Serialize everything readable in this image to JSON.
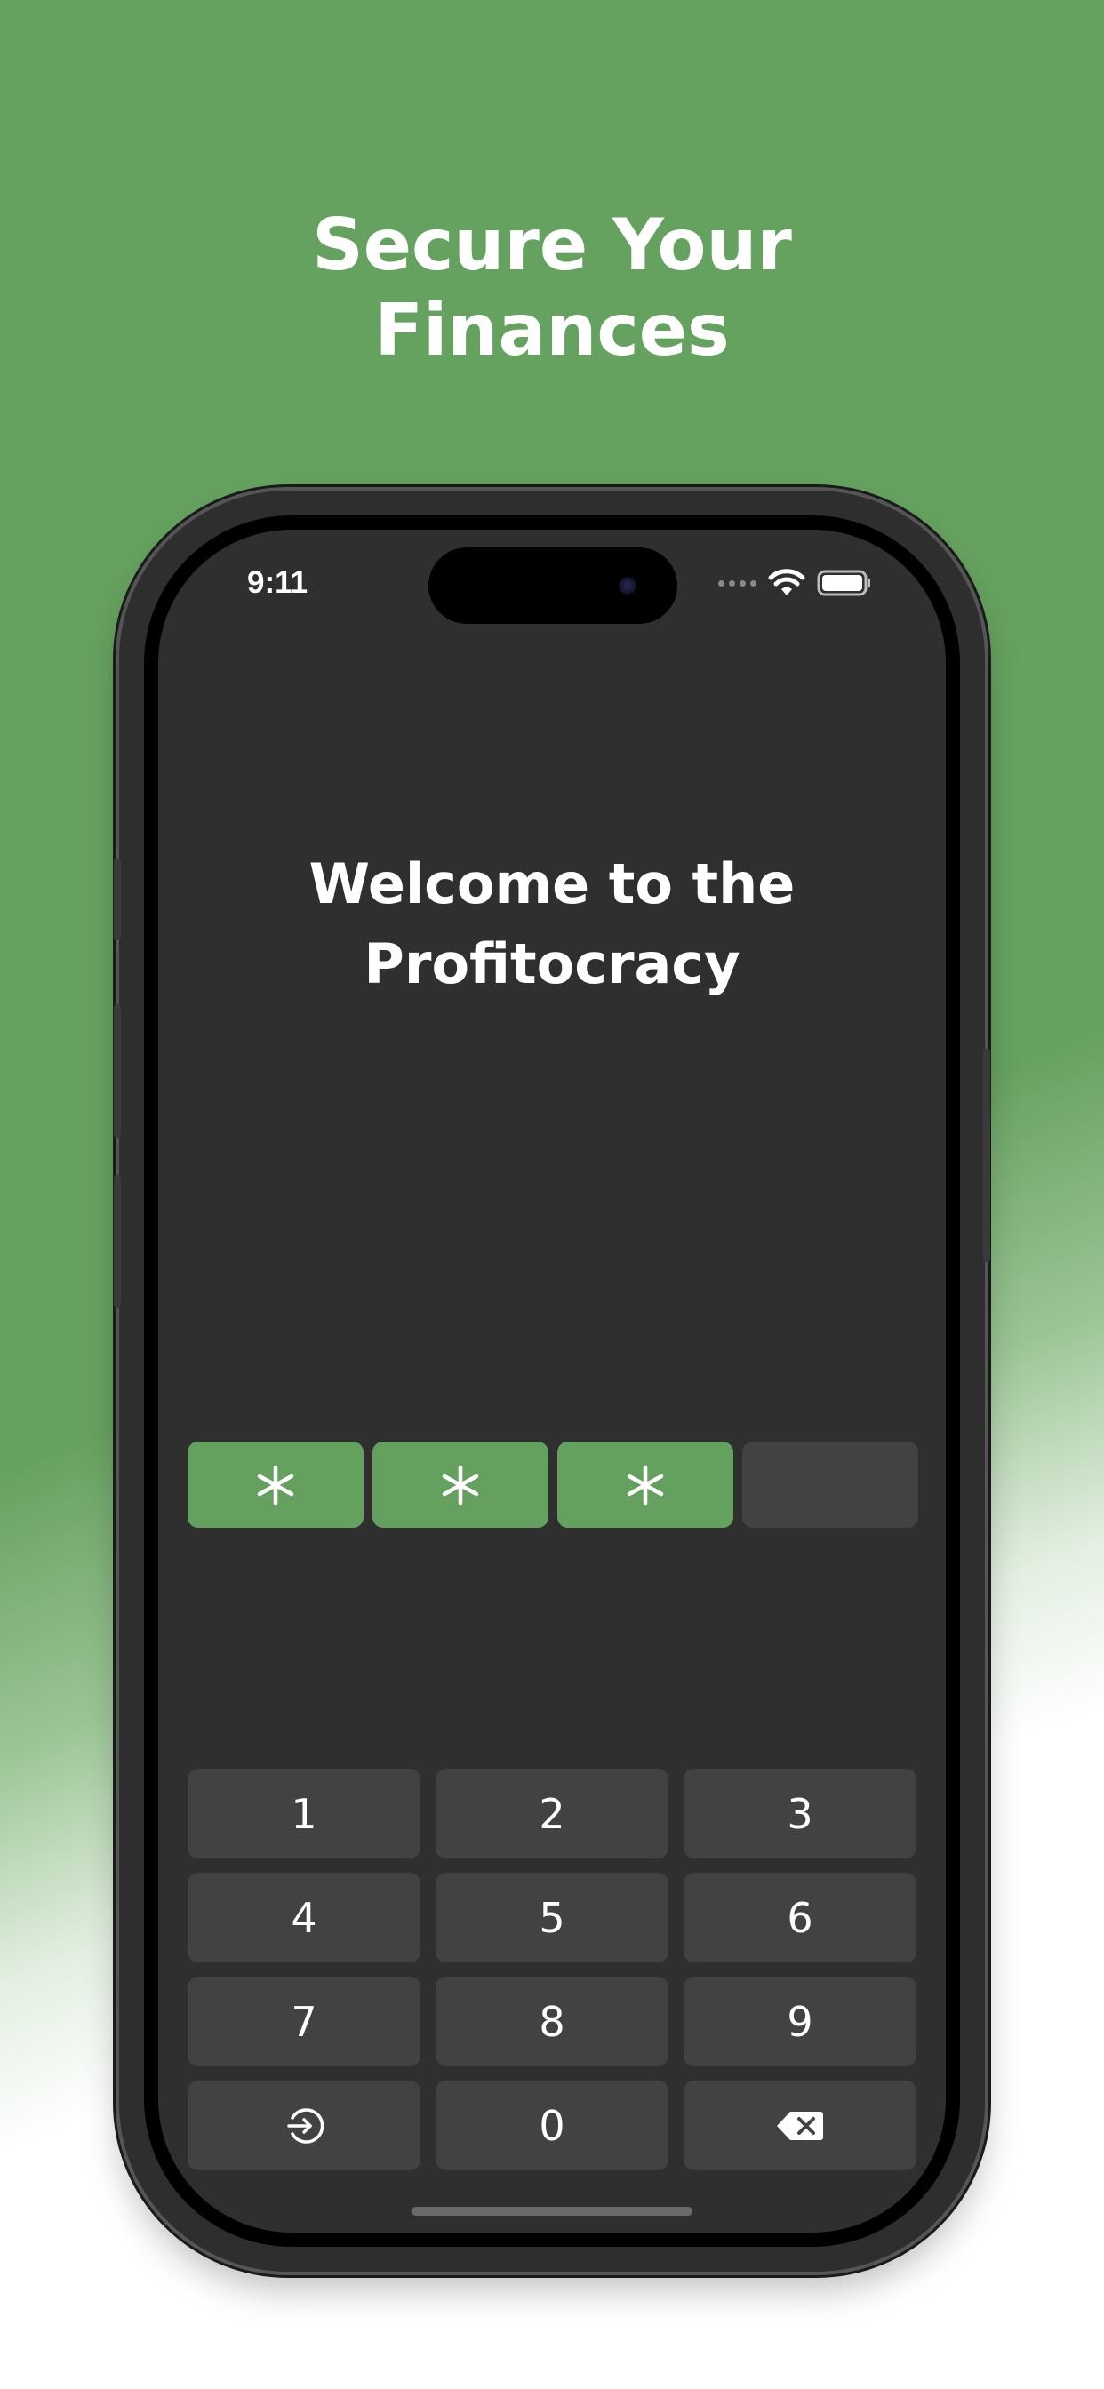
{
  "headline": {
    "line1": "Secure Your",
    "line2": "Finances"
  },
  "status_bar": {
    "time": "9:11",
    "icons": [
      "signal-dots-icon",
      "wifi-icon",
      "battery-icon"
    ]
  },
  "welcome": {
    "line1": "Welcome to the",
    "line2": "Profitocracy"
  },
  "pin": {
    "mask_symbol": "*",
    "digits_entered": 3,
    "total_digits": 4,
    "boxes": [
      "*",
      "*",
      "*",
      ""
    ]
  },
  "keypad": {
    "keys": [
      {
        "label": "1"
      },
      {
        "label": "2"
      },
      {
        "label": "3"
      },
      {
        "label": "4"
      },
      {
        "label": "5"
      },
      {
        "label": "6"
      },
      {
        "label": "7"
      },
      {
        "label": "8"
      },
      {
        "label": "9"
      },
      {
        "label": "",
        "icon": "login-icon"
      },
      {
        "label": "0"
      },
      {
        "label": "",
        "icon": "backspace-icon"
      }
    ]
  },
  "colors": {
    "accent": "#65a15e",
    "background_green": "#66a25f",
    "screen_bg": "#2f2f2f",
    "key_bg": "#424242",
    "text": "#ffffff"
  }
}
